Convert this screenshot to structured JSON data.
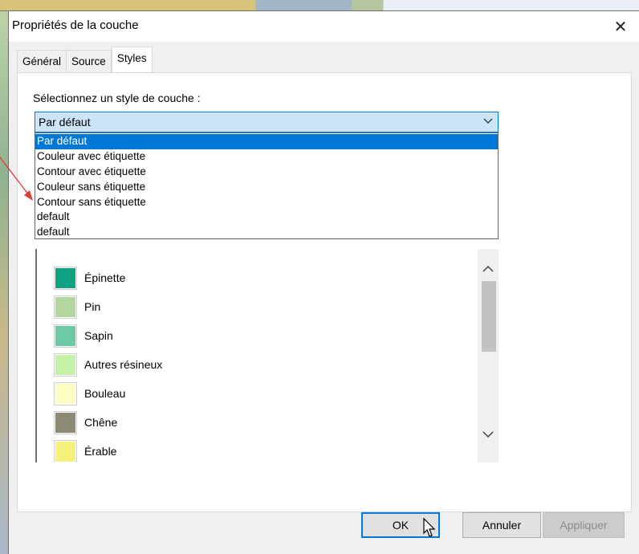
{
  "window": {
    "title": "Propriétés de la couche",
    "close_glyph": "✕"
  },
  "tabs": [
    {
      "label": "Général",
      "active": false
    },
    {
      "label": "Source",
      "active": false
    },
    {
      "label": "Styles",
      "active": true
    }
  ],
  "styles": {
    "prompt": "Sélectionnez un style de couche :",
    "selected": "Par défaut",
    "options": [
      "Par défaut",
      "Couleur avec étiquette",
      "Contour avec étiquette",
      "Couleur sans étiquette",
      "Contour sans étiquette",
      "default",
      "default"
    ],
    "highlighted_index": 0
  },
  "legend": {
    "items": [
      {
        "label": "Épinette",
        "color": "#0ea283"
      },
      {
        "label": "Pin",
        "color": "#b3d5a0"
      },
      {
        "label": "Sapin",
        "color": "#6ccba6"
      },
      {
        "label": "Autres résineux",
        "color": "#c3f2a7"
      },
      {
        "label": "Bouleau",
        "color": "#fdfdc3"
      },
      {
        "label": "Chêne",
        "color": "#8e8a73"
      },
      {
        "label": "Érable",
        "color": "#f6f17b"
      }
    ]
  },
  "buttons": {
    "ok": "OK",
    "cancel": "Annuler",
    "apply": "Appliquer"
  },
  "colors": {
    "accent": "#0078d7",
    "annotation_arrow": "#e53935"
  },
  "icons": {
    "close": "close-icon",
    "dropdown": "chevron-down-icon",
    "scroll_up": "chevron-up-icon",
    "scroll_down": "chevron-down-icon",
    "cursor": "mouse-cursor-icon"
  }
}
